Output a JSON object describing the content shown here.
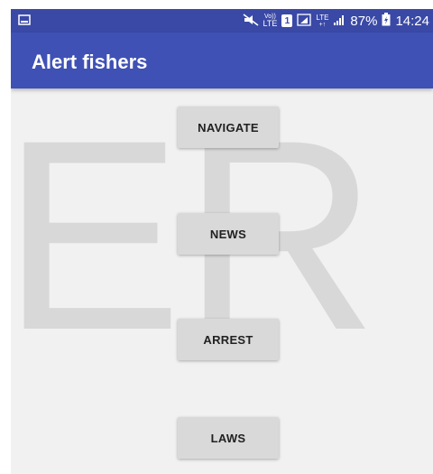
{
  "status_bar": {
    "volte_label_top": "Vo))",
    "volte_label_bottom": "LTE",
    "sim_number": "1",
    "network_label_top": "LTE",
    "network_label_bottom": "+↑",
    "battery_percent": "87%",
    "time": "14:24",
    "icons": [
      "gallery-notification-icon",
      "mute-icon",
      "volte-icon",
      "sim-icon",
      "signal-icon",
      "lte-icon",
      "signal-bars-icon",
      "battery-icon"
    ]
  },
  "app_bar": {
    "title": "Alert fishers"
  },
  "watermark": {
    "text": "ER"
  },
  "buttons": {
    "navigate": "NAVIGATE",
    "news": "NEWS",
    "arrest": "ARREST",
    "laws": "LAWS"
  },
  "colors": {
    "status_bar": "#3a49a6",
    "app_bar": "#3f51b5",
    "background": "#f1f1f1",
    "button": "#d9d9d9",
    "watermark": "#d8d8d8"
  }
}
